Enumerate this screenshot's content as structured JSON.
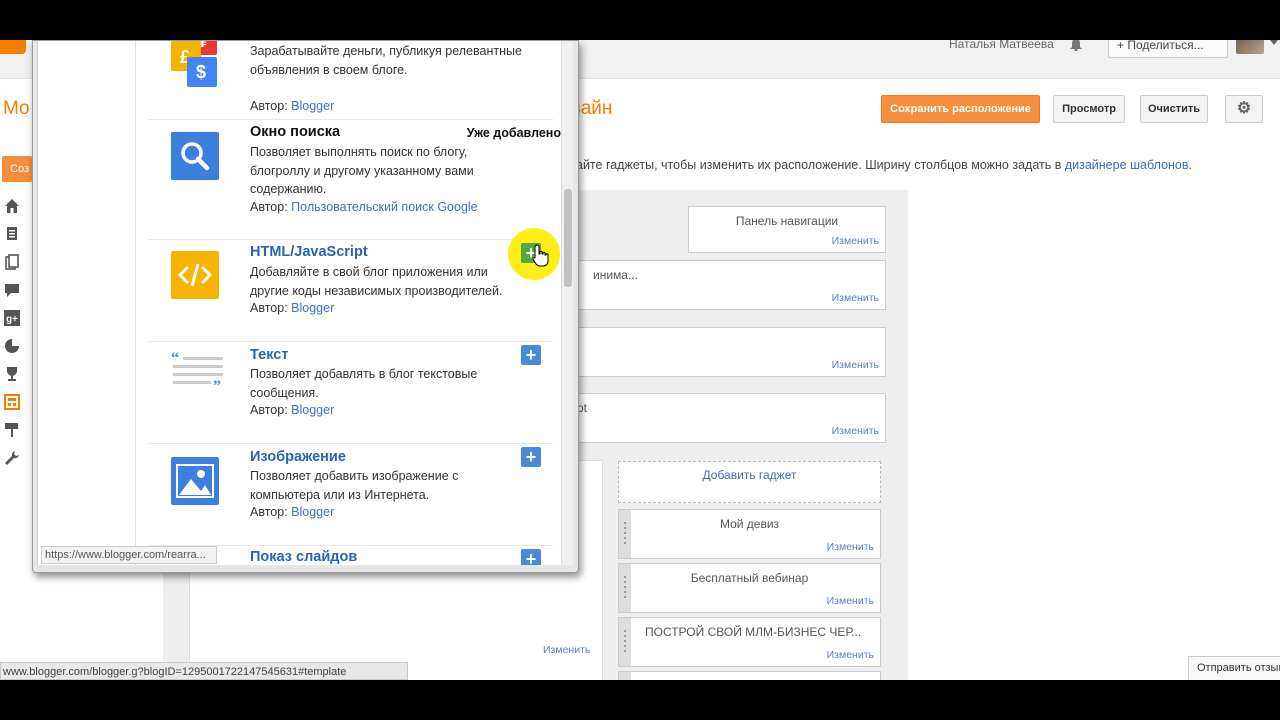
{
  "topbar": {
    "user_name": "Наталья Матвеева",
    "share_label": "+ Поделиться..."
  },
  "header": {
    "title_left": "Мо",
    "title_right": "зайн",
    "save_label": "Сохранить расположение",
    "preview_label": "Просмотр",
    "clear_label": "Очистить",
    "hint_text": "айте гаджеты, чтобы изменить их расположение. Ширину столбцов можно задать в ",
    "hint_link": "дизайнере шаблонов",
    "hint_end": "."
  },
  "sidebar": {
    "create_label": "Соз",
    "icons": [
      "home-icon",
      "posts-icon",
      "pages-icon",
      "comments-icon",
      "google-plus-icon",
      "stats-icon",
      "earnings-icon",
      "layout-icon",
      "template-icon",
      "settings-icon"
    ]
  },
  "layout": {
    "edit_label": "Изменить",
    "nav_gadget": "Панель навигации",
    "partial_1": "инима...",
    "partial_2": "pt",
    "add_gadget": "Добавить гаджет",
    "gadgets": [
      {
        "title": "Мой девиз"
      },
      {
        "title": "Бесплатный вебинар"
      },
      {
        "title": "ПОСТРОЙ СВОЙ МЛМ-БИЗНЕС ЧЕР..."
      }
    ]
  },
  "popup": {
    "status_url": "https://www.blogger.com/rearra...",
    "items": [
      {
        "desc": "Зарабатывайте деньги, публикуя релевантные объявления в своем блоге.",
        "author_label": "Автор:",
        "author": "Blogger"
      },
      {
        "name": "Окно поиска",
        "added": "Уже добавлено",
        "desc": "Позволяет выполнять поиск по блогу, блогроллу и другому указанному вами содержанию.",
        "author_label": "Автор:",
        "author": "Пользовательский поиск Google"
      },
      {
        "name": "HTML/JavaScript",
        "desc": "Добавляйте в свой блог приложения или другие коды независимых производителей.",
        "author_label": "Автор:",
        "author": "Blogger"
      },
      {
        "name": "Текст",
        "desc": "Позволяет добавлять в блог текстовые сообщения.",
        "author_label": "Автор:",
        "author": "Blogger"
      },
      {
        "name": "Изображение",
        "desc": "Позволяет добавить изображение с компьютера или из Интернета.",
        "author_label": "Автор:",
        "author": "Blogger"
      },
      {
        "name": "Показ слайдов"
      }
    ]
  },
  "statusbar": {
    "url": "www.blogger.com/blogger.g?blogID=1295001722147545631#template"
  },
  "feedback": {
    "label": "Отправить отзыв"
  },
  "colors": {
    "accent": "#f57d00",
    "link": "#2a62b4",
    "plus": "#4a8ad8"
  }
}
